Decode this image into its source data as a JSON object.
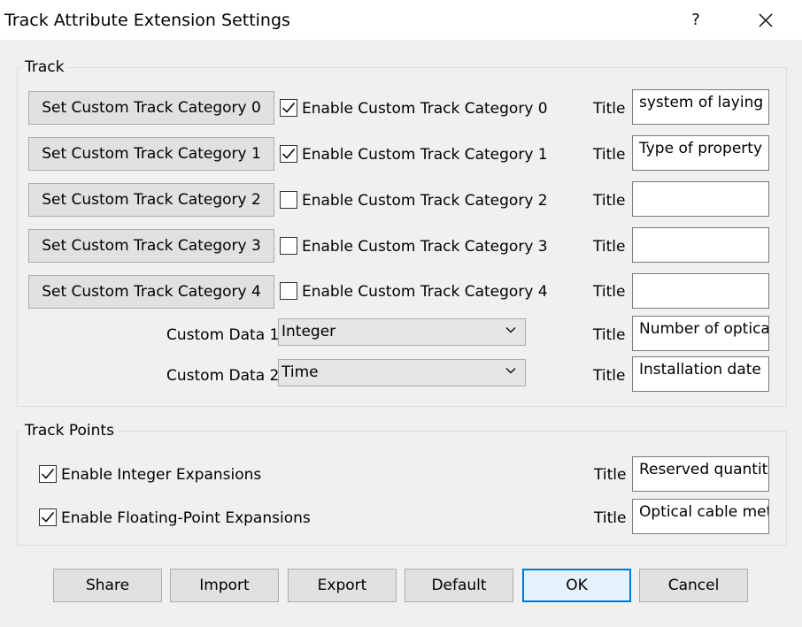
{
  "window": {
    "title": "Track Attribute Extension Settings",
    "help_glyph": "?"
  },
  "track_group": {
    "label": "Track",
    "rows": [
      {
        "button": "Set Custom Track Category 0",
        "checkbox_label": "Enable Custom Track Category 0",
        "checked": true,
        "title_label": "Title",
        "title_value": "system of laying"
      },
      {
        "button": "Set Custom Track Category 1",
        "checkbox_label": "Enable Custom Track Category 1",
        "checked": true,
        "title_label": "Title",
        "title_value": "Type of property"
      },
      {
        "button": "Set Custom Track Category 2",
        "checkbox_label": "Enable Custom Track Category 2",
        "checked": false,
        "title_label": "Title",
        "title_value": ""
      },
      {
        "button": "Set Custom Track Category 3",
        "checkbox_label": "Enable Custom Track Category 3",
        "checked": false,
        "title_label": "Title",
        "title_value": ""
      },
      {
        "button": "Set Custom Track Category 4",
        "checkbox_label": "Enable Custom Track Category 4",
        "checked": false,
        "title_label": "Title",
        "title_value": ""
      }
    ],
    "custom_data": [
      {
        "label": "Custom Data 1",
        "selected": "Integer",
        "title_label": "Title",
        "title_value": "Number of optica"
      },
      {
        "label": "Custom Data 2",
        "selected": "Time",
        "title_label": "Title",
        "title_value": "Installation date"
      }
    ]
  },
  "track_points_group": {
    "label": "Track Points",
    "rows": [
      {
        "checkbox_label": "Enable Integer Expansions",
        "checked": true,
        "title_label": "Title",
        "title_value": "Reserved quantity"
      },
      {
        "checkbox_label": "Enable Floating-Point Expansions",
        "checked": true,
        "title_label": "Title",
        "title_value": "Optical cable met"
      }
    ]
  },
  "footer": {
    "share": "Share",
    "import": "Import",
    "export": "Export",
    "default": "Default",
    "ok": "OK",
    "cancel": "Cancel"
  },
  "icons": {
    "close": "close-icon",
    "check": "checkmark-icon",
    "dropdown": "chevron-down-icon"
  },
  "colors": {
    "accent": "#0078d7",
    "dialog_bg": "#f0f0f0",
    "button_bg": "#e1e1e1"
  }
}
